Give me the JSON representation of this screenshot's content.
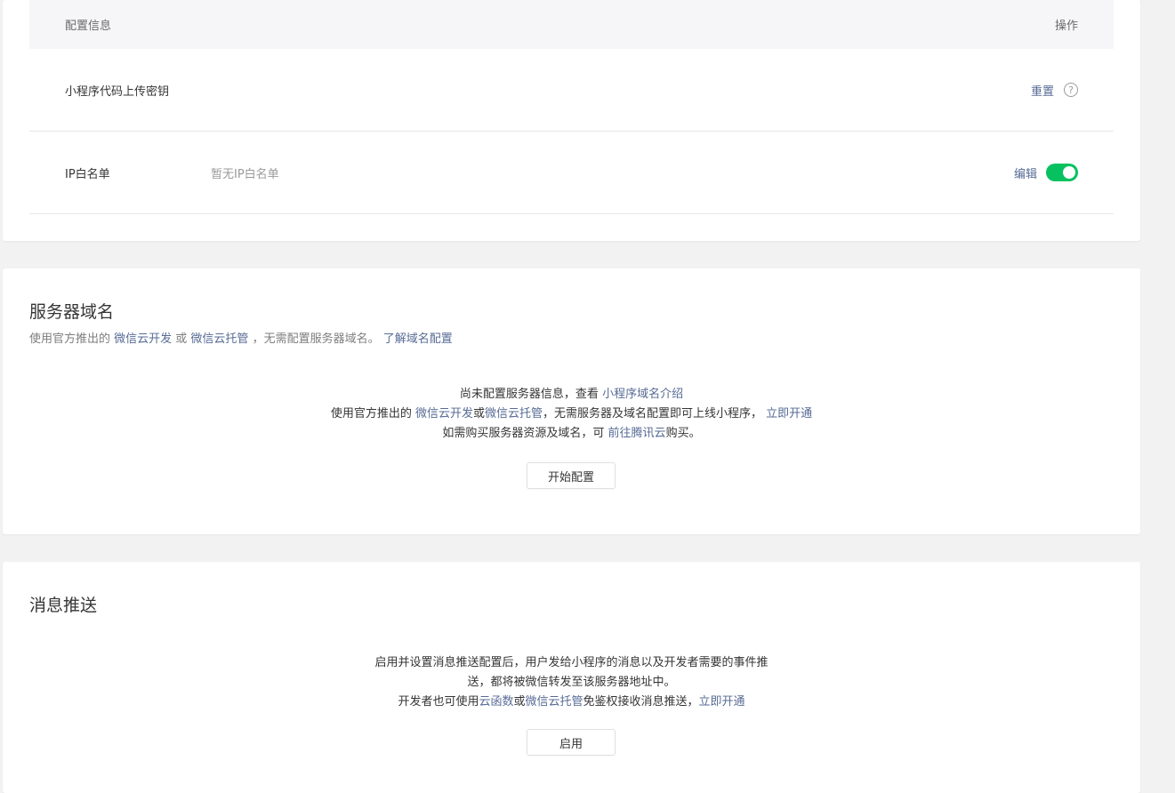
{
  "config_table": {
    "header_left": "配置信息",
    "header_right": "操作",
    "rows": [
      {
        "label": "小程序代码上传密钥",
        "value": "",
        "action": "重置"
      },
      {
        "label": "IP白名单",
        "value": "暂无IP白名单",
        "action": "编辑",
        "toggle_on": true
      }
    ]
  },
  "server_domain": {
    "title": "服务器域名",
    "desc_prefix": "使用官方推出的 ",
    "desc_link1": "微信云开发",
    "desc_mid1": " 或 ",
    "desc_link2": "微信云托管",
    "desc_mid2": " ，无需配置服务器域名。 ",
    "desc_link3": "了解域名配置",
    "line1_prefix": "尚未配置服务器信息，查看 ",
    "line1_link": "小程序域名介绍",
    "line2_prefix": "使用官方推出的 ",
    "line2_link1": "微信云开发",
    "line2_or": "或",
    "line2_link2": "微信云托管",
    "line2_mid": "，无需服务器及域名配置即可上线小程序， ",
    "line2_link3": "立即开通",
    "line3_prefix": "如需购买服务器资源及域名，可 ",
    "line3_link": "前往腾讯云",
    "line3_suffix": "购买。",
    "button": "开始配置"
  },
  "message_push": {
    "title": "消息推送",
    "line1": "启用并设置消息推送配置后，用户发给小程序的消息以及开发者需要的事件推",
    "line2": "送，都将被微信转发至该服务器地址中。",
    "line3_prefix": "开发者也可使用",
    "line3_link1": "云函数",
    "line3_or": "或",
    "line3_link2": "微信云托管",
    "line3_mid": "免鉴权接收消息推送，",
    "line3_link3": "立即开通",
    "button": "启用"
  },
  "colors": {
    "link": "#576b95",
    "toggle_on": "#07c160",
    "page_bg": "#f2f2f2"
  }
}
